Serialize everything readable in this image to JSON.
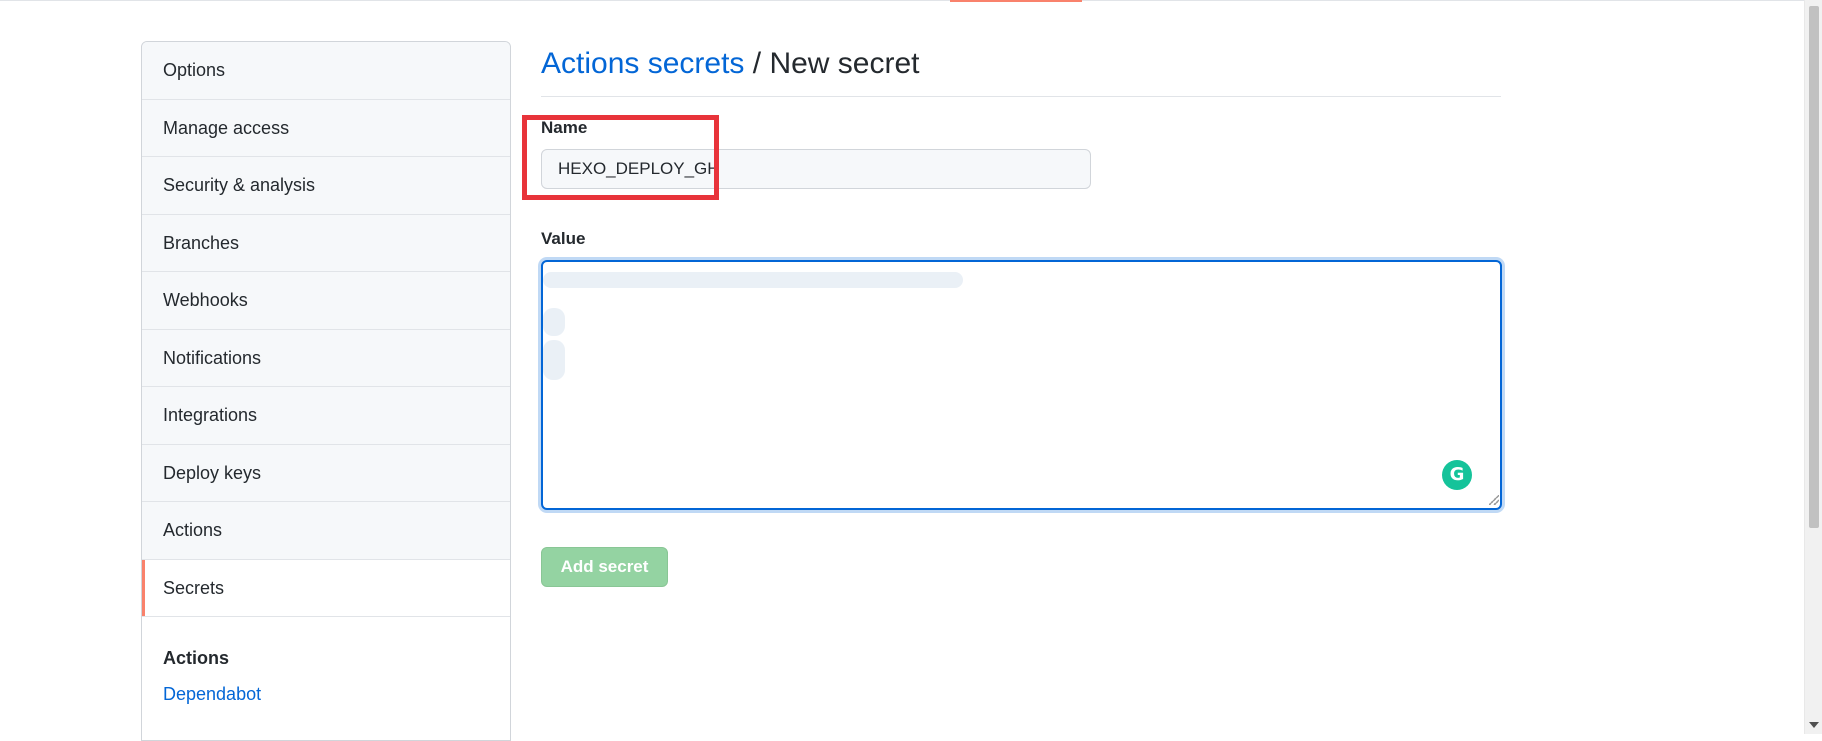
{
  "sidebar": {
    "items": [
      {
        "label": "Options"
      },
      {
        "label": "Manage access"
      },
      {
        "label": "Security & analysis"
      },
      {
        "label": "Branches"
      },
      {
        "label": "Webhooks"
      },
      {
        "label": "Notifications"
      },
      {
        "label": "Integrations"
      },
      {
        "label": "Deploy keys"
      },
      {
        "label": "Actions"
      },
      {
        "label": "Secrets",
        "selected": true
      }
    ],
    "section": {
      "title": "Actions",
      "link": "Dependabot"
    }
  },
  "header": {
    "breadcrumb_link": "Actions secrets",
    "separator": " / ",
    "title": "New secret"
  },
  "form": {
    "name_label": "Name",
    "name_value": "HEXO_DEPLOY_GH",
    "value_label": "Value",
    "value_text": "",
    "submit_label": "Add secret"
  },
  "colors": {
    "link": "#0366d6",
    "selected_accent": "#f9826c",
    "highlight": "#e8333a",
    "button_disabled": "#94d3a2",
    "grammarly": "#15c39a"
  },
  "icons": {
    "grammarly": "grammarly-icon",
    "resize": "resize-handle-icon"
  }
}
